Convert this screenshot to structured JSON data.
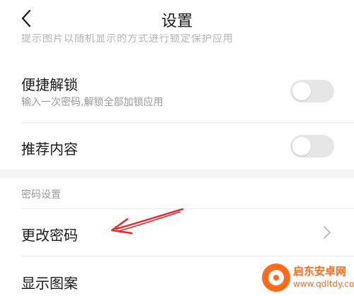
{
  "header": {
    "title": "设置"
  },
  "top_partial_text": "提示图片以随机显示的方式进行锁定保护应用",
  "quick_unlock": {
    "title": "便捷解锁",
    "subtitle": "输入一次密码,解锁全部加锁应用",
    "enabled": false
  },
  "recommend": {
    "title": "推荐内容",
    "enabled": false
  },
  "password_section": {
    "header": "密码设置"
  },
  "change_password": {
    "title": "更改密码"
  },
  "show_pattern": {
    "title": "显示图案"
  },
  "watermark": {
    "name": "启东安卓网",
    "url": "www.qdltdy.com"
  },
  "icons": [
    "back-arrow-icon",
    "chevron-right-icon",
    "red-arrow-annotation"
  ],
  "colors": {
    "toggle_off": "#e6e6e6",
    "annotation": "#e8262b",
    "watermark": "#ff6b1a",
    "section_gap": "#f4f4f4"
  }
}
